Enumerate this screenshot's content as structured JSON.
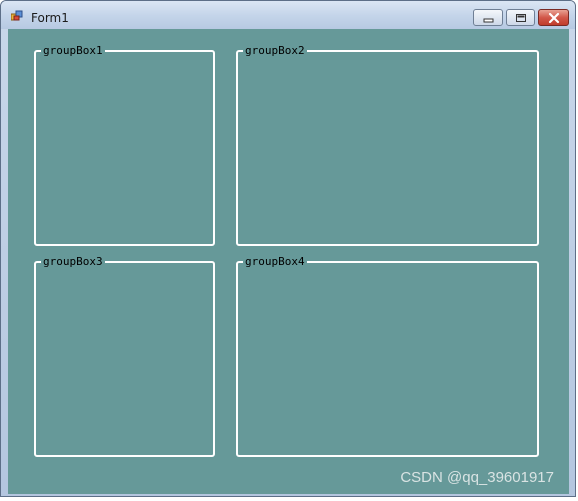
{
  "window": {
    "title": "Form1",
    "client_color": "#669999",
    "controls": {
      "minimize_icon": "minimize-icon",
      "maximize_icon": "maximize-icon",
      "close_icon": "close-icon"
    }
  },
  "group_boxes": [
    {
      "label": "groupBox1"
    },
    {
      "label": "groupBox2"
    },
    {
      "label": "groupBox3"
    },
    {
      "label": "groupBox4"
    }
  ],
  "watermark": "CSDN @qq_39601917"
}
